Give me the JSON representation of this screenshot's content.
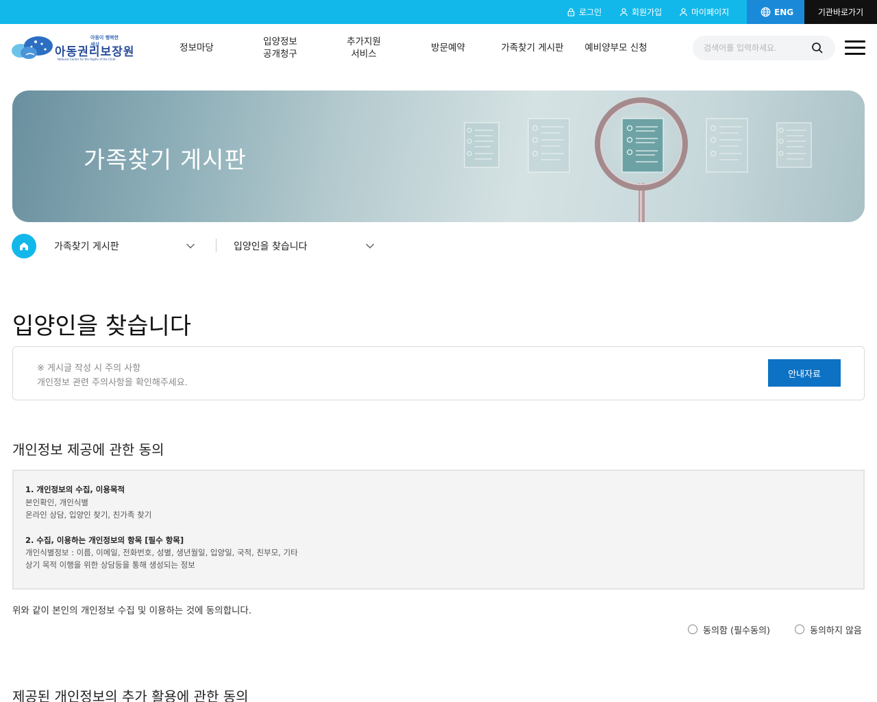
{
  "topbar": {
    "login": "로그인",
    "join": "회원가입",
    "mypage": "마이페이지",
    "eng": "ENG",
    "institutions": "기관바로가기"
  },
  "logo": {
    "tagline": "아동이 행복한 세상",
    "name": "아동권리보장원",
    "english": "National Center for the Rights of the Child"
  },
  "gnb": {
    "item1": "정보마당",
    "item2_line1": "입양정보",
    "item2_line2": "공개청구",
    "item3_line1": "추가지원",
    "item3_line2": "서비스",
    "item4": "방문예약",
    "item5": "가족찾기 게시판",
    "item6": "예비양부모 신청"
  },
  "search": {
    "placeholder": "검색어를 입력하세요."
  },
  "hero": {
    "title": "가족찾기 게시판"
  },
  "location": {
    "depth1": "가족찾기 게시판",
    "depth2": "입양인을 찾습니다"
  },
  "page": {
    "title": "입양인을 찾습니다",
    "notice_line1": "※ 게시글 작성 시 주의 사항",
    "notice_line2": "개인정보 관련 주의사항을 확인해주세요.",
    "guide_button": "안내자료"
  },
  "consent1": {
    "title": "개인정보 제공에 관한 동의",
    "h1": "1. 개인정보의 수집, 이용목적",
    "l1": "본인확인, 개인식별",
    "l2": "온라인 상담, 입양인 찾기, 친가족 찾기",
    "h2": "2. 수집, 이용하는 개인정보의 항목 [필수 항목]",
    "l3": "개인식별정보 : 이름, 이메일, 전화번호, 성별, 생년월일, 입양일, 국적, 친부모, 기타",
    "l4": "상기 목적 이행을 위한 상담등을 통해 생성되는 정보",
    "agree_text": "위와 같이 본인의 개인정보 수집 및 이용하는 것에 동의합니다.",
    "agree_option": "동의함 (필수동의)",
    "disagree_option": "동의하지 않음"
  },
  "consent2": {
    "title": "제공된 개인정보의 추가 활용에 관한 동의"
  },
  "colors": {
    "topbar": "#12b8ea",
    "eng_bg": "#1a8ad8",
    "institutions_bg": "#111111",
    "primary_button": "#0d72c4"
  },
  "icons": [
    "lock-icon",
    "user-icon",
    "globe-icon",
    "search-icon",
    "menu-icon",
    "home-icon",
    "chevron-down-icon"
  ]
}
